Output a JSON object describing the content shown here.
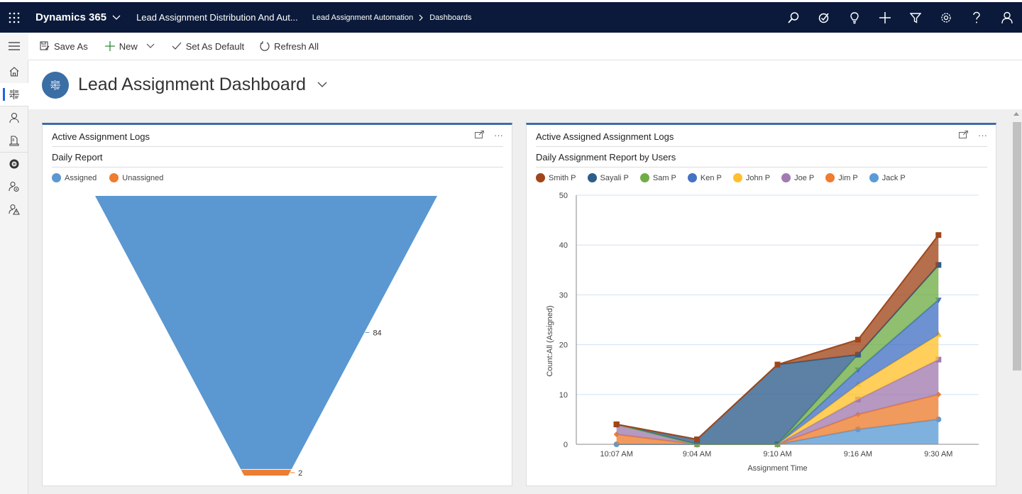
{
  "topbar": {
    "brand": "Dynamics 365",
    "app_name": "Lead Assignment Distribution And Aut...",
    "breadcrumb": [
      "Lead Assignment Automation",
      "Dashboards"
    ],
    "icons": [
      "search-icon",
      "task-icon",
      "lightbulb-icon",
      "plus-icon",
      "filter-icon",
      "settings-icon",
      "help-icon",
      "user-icon"
    ]
  },
  "commands": {
    "save_as": "Save As",
    "new": "New",
    "set_default": "Set As Default",
    "refresh_all": "Refresh All"
  },
  "sidenav": {
    "items": [
      "home",
      "dashboards",
      "contacts",
      "documents",
      "assignment",
      "user-settings",
      "user-alerts"
    ]
  },
  "dashboard": {
    "title": "Lead Assignment Dashboard"
  },
  "panels": [
    {
      "title": "Active Assignment Logs",
      "subtitle": "Daily Report",
      "more": "···"
    },
    {
      "title": "Active Assigned Assignment Logs",
      "subtitle": "Daily Assignment Report by Users",
      "more": "···"
    }
  ],
  "chart_data": [
    {
      "type": "funnel",
      "title": "Daily Report",
      "categories": [
        "Assigned",
        "Unassigned"
      ],
      "values": [
        84,
        2
      ],
      "colors": [
        "#5b97d1",
        "#ed7d31"
      ],
      "legend": "top-left"
    },
    {
      "type": "area",
      "stacked": true,
      "title": "Daily Assignment Report by Users",
      "xlabel": "Assignment Time",
      "ylabel": "Count:All (Assigned)",
      "ylim": [
        0,
        50
      ],
      "yticks": [
        0,
        10,
        20,
        30,
        40,
        50
      ],
      "categories": [
        "10:07 AM",
        "9:04 AM",
        "9:10 AM",
        "9:16 AM",
        "9:30 AM"
      ],
      "grid": true,
      "legend": "top-left",
      "series": [
        {
          "name": "Jack P",
          "color": "#5b9bd5",
          "marker": "circle",
          "values": [
            0,
            0,
            0,
            3,
            5
          ]
        },
        {
          "name": "Jim P",
          "color": "#ed7d31",
          "marker": "diamond",
          "values": [
            2,
            0,
            0,
            3,
            5
          ]
        },
        {
          "name": "Joe P",
          "color": "#a27bb0",
          "marker": "square",
          "values": [
            2,
            0,
            0,
            3,
            7
          ]
        },
        {
          "name": "John P",
          "color": "#ffc02d",
          "marker": "triangle",
          "values": [
            0,
            0,
            0,
            3,
            5
          ]
        },
        {
          "name": "Ken P",
          "color": "#4472c4",
          "marker": "triangle-down",
          "values": [
            0,
            0,
            0,
            3,
            7
          ]
        },
        {
          "name": "Sam P",
          "color": "#70ad47",
          "marker": "circle",
          "values": [
            0,
            0,
            0,
            3,
            7
          ]
        },
        {
          "name": "Sayali P",
          "color": "#2e5d8a",
          "marker": "square",
          "values": [
            0,
            1,
            16,
            0,
            0
          ]
        },
        {
          "name": "Smith P",
          "color": "#a0461a",
          "marker": "square",
          "values": [
            0,
            0,
            0,
            3,
            6
          ]
        }
      ],
      "legend_order": [
        "Smith P",
        "Sayali P",
        "Sam P",
        "Ken P",
        "John P",
        "Joe P",
        "Jim P",
        "Jack P"
      ]
    }
  ]
}
